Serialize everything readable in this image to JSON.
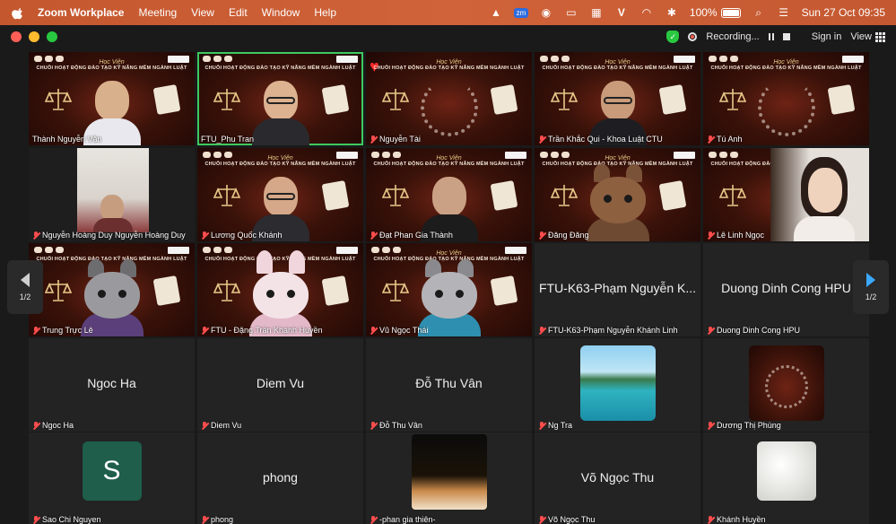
{
  "menubar": {
    "app": "Zoom Workplace",
    "items": [
      "Meeting",
      "View",
      "Edit",
      "Window",
      "Help"
    ],
    "zm_badge": "zm",
    "battery": "100%",
    "battery_level": 1.0,
    "datetime": "Sun 27 Oct  09:35"
  },
  "titlebar": {
    "recording": "Recording...",
    "sign_in": "Sign in",
    "view": "View"
  },
  "nav": {
    "page_left": "1/2",
    "page_right": "1/2"
  },
  "poster": {
    "heading": "Học Viên",
    "subtitle": "CHUỖI HOẠT ĐỘNG ĐÀO TẠO KỸ NĂNG MỀM NGÀNH LUẬT"
  },
  "participants": [
    {
      "name": "Thành Nguyễn Văn"
    },
    {
      "name": "FTU_Phu Tran"
    },
    {
      "name": "Nguyễn Tài"
    },
    {
      "name": "Trần Khắc Qui - Khoa Luật CTU"
    },
    {
      "name": "Tú Anh"
    },
    {
      "name": "Nguyễn Hoàng Duy Nguyễn Hoàng Duy"
    },
    {
      "name": "Lương Quốc Khánh"
    },
    {
      "name": "Đạt Phan Gia Thành"
    },
    {
      "name": "Đăng Đăng"
    },
    {
      "name": "Lê Linh Ngọc"
    },
    {
      "name": "Trung Trực Lê"
    },
    {
      "name": "FTU - Đặng Trần Khánh Huyền"
    },
    {
      "name": "Vũ Ngọc Thái"
    },
    {
      "name": "FTU-K63-Phạm Nguyễn Khánh Linh",
      "big": "FTU-K63-Phạm Nguyễn K..."
    },
    {
      "name": "Duong Dinh Cong HPU",
      "big": "Duong Dinh Cong HPU"
    },
    {
      "name": "Ngoc Ha",
      "big": "Ngoc Ha"
    },
    {
      "name": "Diem Vu",
      "big": "Diem Vu"
    },
    {
      "name": "Đỗ Thu Vân",
      "big": "Đỗ Thu Vân"
    },
    {
      "name": "Ng Tra"
    },
    {
      "name": "Dương Thị Phùng"
    },
    {
      "name": "Sao Chi Nguyen",
      "avatar_letter": "S"
    },
    {
      "name": "phong",
      "big": "phong"
    },
    {
      "name": "-phan gia thiên-"
    },
    {
      "name": "Võ Ngọc Thu",
      "big": "Võ Ngọc Thu"
    },
    {
      "name": "Khánh Huyền"
    }
  ],
  "colors": {
    "accent_green": "#3ec95f",
    "mute_red": "#ff4d4d",
    "nav_blue": "#3aa8ff",
    "avatar_s": "#1e5e4a"
  }
}
